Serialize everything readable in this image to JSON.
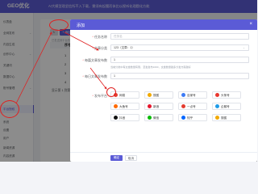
{
  "app": {
    "logo_text": "GEO优化",
    "top_notice": "AI大模型理坚信所不入下载，需须有起腰而体比以视听化理题化方能"
  },
  "colors": {
    "brand": "#5b5bd6",
    "annotation": "#e02020"
  },
  "sidebar": {
    "items": [
      {
        "label": "仪表盘"
      },
      {
        "label": "全网发布"
      },
      {
        "label": "内容生成"
      },
      {
        "label": "创作中心"
      },
      {
        "label": "关键词"
      },
      {
        "label": "数据中心"
      },
      {
        "label": "账号管理"
      },
      {
        "label": "平台授权"
      },
      {
        "label": "系统"
      },
      {
        "label": "设置"
      },
      {
        "label": "用户"
      },
      {
        "label": "新闻资源"
      },
      {
        "label": "内容资源"
      }
    ]
  },
  "toolbar": {
    "refresh_label": "↻",
    "add_label": "+ 添加"
  },
  "list": {
    "hint": "已发送到平台的数据列表",
    "col_num": "序号",
    "row_numbers": [
      "1",
      "2",
      "3",
      "4"
    ],
    "paging": "显示第 1 到第 4 条记录"
  },
  "modal": {
    "title": "添加",
    "close": "×",
    "fields": {
      "task_name_label": "任务名称",
      "task_name_placeholder": "任务名",
      "article_label": "文章分类",
      "article_value": "123（文章：1）",
      "publish_count_label": "每篇文章发布数",
      "publish_count_value": "1",
      "publish_count_help": "当前分类中有文章数量有限，至发发布1000，文章数量越多分发方案越好",
      "interval_label": "每日文章发布数",
      "interval_value": "1",
      "platform_label": "发布平台"
    },
    "platforms": [
      {
        "name": "网易",
        "color": "#e43c2f"
      },
      {
        "name": "搜狐",
        "color": "#f2a900"
      },
      {
        "name": "百家号",
        "color": "#3d7bf5"
      },
      {
        "name": "头条号",
        "color": "#e8362e"
      },
      {
        "name": "大鱼号",
        "color": "#ff6a00"
      },
      {
        "name": "新浪",
        "color": "#e6162d"
      },
      {
        "name": "一点号",
        "color": "#e43c2f"
      },
      {
        "name": "企鹅号",
        "color": "#1e9be8"
      },
      {
        "name": "抖音",
        "color": "#111111"
      },
      {
        "name": "微信",
        "color": "#09bb07"
      },
      {
        "name": "知乎",
        "color": "#0066ff"
      },
      {
        "name": "搜狐",
        "color": "#f2a900"
      }
    ],
    "ok_label": "确定",
    "cancel_label": "取消"
  }
}
